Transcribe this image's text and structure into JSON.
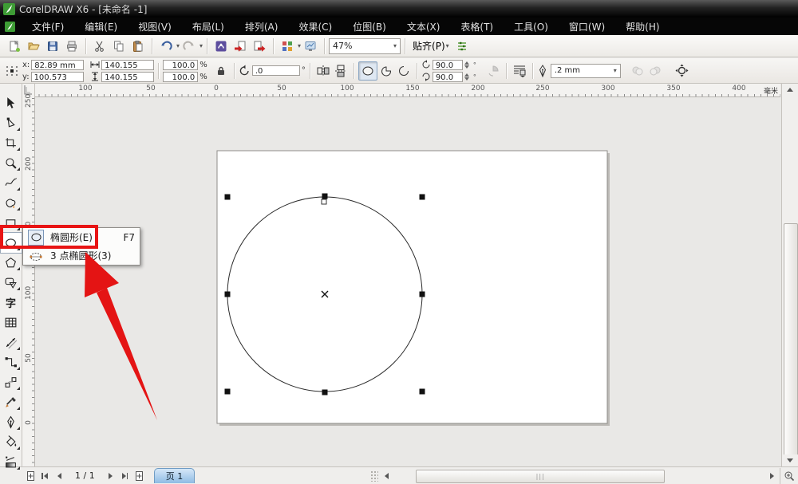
{
  "window": {
    "title": "CorelDRAW X6 - [未命名 -1]"
  },
  "menubar": {
    "items": [
      {
        "label": "文件(F)"
      },
      {
        "label": "编辑(E)"
      },
      {
        "label": "视图(V)"
      },
      {
        "label": "布局(L)"
      },
      {
        "label": "排列(A)"
      },
      {
        "label": "效果(C)"
      },
      {
        "label": "位图(B)"
      },
      {
        "label": "文本(X)"
      },
      {
        "label": "表格(T)"
      },
      {
        "label": "工具(O)"
      },
      {
        "label": "窗口(W)"
      },
      {
        "label": "帮助(H)"
      }
    ]
  },
  "toolbar": {
    "zoom_value": "47%",
    "snap_label": "贴齐(P)"
  },
  "property_bar": {
    "x_label": "x:",
    "x_value": "82.89 mm",
    "y_label": "y:",
    "y_value": "100.573 mm",
    "width_value": "140.155 mm",
    "height_value": "140.155 mm",
    "scale_x": "100.0",
    "scale_y": "100.0",
    "percent": "%",
    "rotation_value": ".0",
    "degree": "°",
    "start_angle": "90.0",
    "end_angle": "90.0",
    "outline_width": ".2 mm"
  },
  "rulers": {
    "unit": "毫米",
    "h_numbers": [
      "100",
      "50",
      "0",
      "50",
      "100",
      "150",
      "200",
      "250",
      "300",
      "350",
      "400"
    ],
    "v_numbers": [
      "250",
      "200",
      "150",
      "100",
      "50",
      "0"
    ]
  },
  "toolbox": {
    "text_glyph": "字"
  },
  "flyout": {
    "items": [
      {
        "label": "椭圆形(E)",
        "shortcut": "F7"
      },
      {
        "label": "3 点椭圆形(3)",
        "shortcut": ""
      }
    ]
  },
  "navigator": {
    "page_indicator": "1 / 1",
    "page_tab": "页 1"
  },
  "colors": {
    "highlight_red": "#e81414",
    "page_tab_blue": "#8fbce4",
    "undo_blue": "#3a5f9e"
  }
}
